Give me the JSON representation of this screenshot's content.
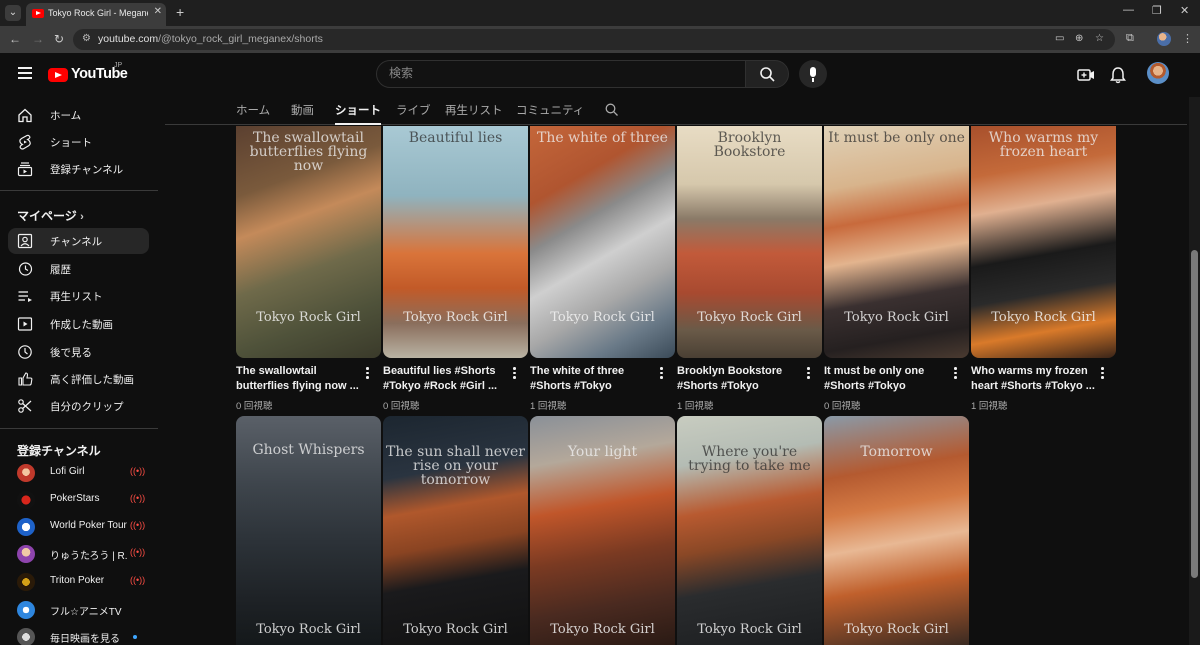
{
  "browser": {
    "tab_title": "Tokyo Rock Girl - Meganex - YouTube",
    "url_host": "youtube.com",
    "url_path": "/@tokyo_rock_girl_meganex/shorts"
  },
  "header": {
    "logo_text": "YouTube",
    "logo_country": "JP",
    "search_placeholder": "検索"
  },
  "sidebar": {
    "main": [
      {
        "label": "ホーム",
        "icon": "home-icon"
      },
      {
        "label": "ショート",
        "icon": "shorts-icon"
      },
      {
        "label": "登録チャンネル",
        "icon": "subscriptions-icon"
      }
    ],
    "mypage_heading": "マイページ",
    "mypage": [
      {
        "label": "チャンネル",
        "icon": "channel-icon",
        "active": true
      },
      {
        "label": "履歴",
        "icon": "history-icon"
      },
      {
        "label": "再生リスト",
        "icon": "playlist-icon"
      },
      {
        "label": "作成した動画",
        "icon": "your-videos-icon"
      },
      {
        "label": "後で見る",
        "icon": "watch-later-icon"
      },
      {
        "label": "高く評価した動画",
        "icon": "liked-icon"
      },
      {
        "label": "自分のクリップ",
        "icon": "clips-icon"
      }
    ],
    "subs_heading": "登録チャンネル",
    "subscriptions": [
      {
        "label": "Lofi Girl",
        "status": "live",
        "color": "#c0392b"
      },
      {
        "label": "PokerStars",
        "status": "live",
        "color": "#d8261c"
      },
      {
        "label": "World Poker Tour",
        "status": "live",
        "color": "#1e62c9"
      },
      {
        "label": "りゅうたろう | R...",
        "status": "live",
        "color": "#8e44ad"
      },
      {
        "label": "Triton Poker",
        "status": "live",
        "color": "#d4a017"
      },
      {
        "label": "フル☆アニメTV",
        "status": "none",
        "color": "#2e86de"
      },
      {
        "label": "毎日映画を見る",
        "status": "new",
        "color": "#7f8c8d"
      }
    ]
  },
  "channel_tabs": [
    "ホーム",
    "動画",
    "ショート",
    "ライブ",
    "再生リスト",
    "コミュニティ"
  ],
  "active_tab_index": 2,
  "shorts": [
    {
      "thumb_text": "The swallowtail butterflies flying now",
      "watermark": "Tokyo Rock Girl",
      "title": "The swallowtail butterflies flying now ...",
      "views": "0 回視聴"
    },
    {
      "thumb_text": "Beautiful lies",
      "watermark": "Tokyo Rock Girl",
      "title": "Beautiful lies #Shorts #Tokyo #Rock #Girl ...",
      "views": "0 回視聴"
    },
    {
      "thumb_text": "The white of three",
      "watermark": "Tokyo Rock Girl",
      "title": "The white of three #Shorts #Tokyo #Rock...",
      "views": "1 回視聴"
    },
    {
      "thumb_text": "Brooklyn Bookstore",
      "watermark": "Tokyo Rock Girl",
      "title": "Brooklyn Bookstore #Shorts #Tokyo #Rock...",
      "views": "1 回視聴"
    },
    {
      "thumb_text": "It must be only one",
      "watermark": "Tokyo Rock Girl",
      "title": "It must be only one #Shorts #Tokyo #Rock...",
      "views": "0 回視聴"
    },
    {
      "thumb_text": "Who warms my frozen heart",
      "watermark": "Tokyo Rock Girl",
      "title": "Who warms my frozen heart #Shorts #Tokyo ...",
      "views": "1 回視聴"
    },
    {
      "thumb_text": "Ghost Whispers",
      "watermark": "Tokyo Rock Girl"
    },
    {
      "thumb_text": "The sun shall never rise on your tomorrow",
      "watermark": "Tokyo Rock Girl"
    },
    {
      "thumb_text": "Your light",
      "watermark": "Tokyo Rock Girl"
    },
    {
      "thumb_text": "Where you're trying to take me",
      "watermark": "Tokyo Rock Girl"
    },
    {
      "thumb_text": "Tomorrow",
      "watermark": "Tokyo Rock Girl"
    }
  ]
}
